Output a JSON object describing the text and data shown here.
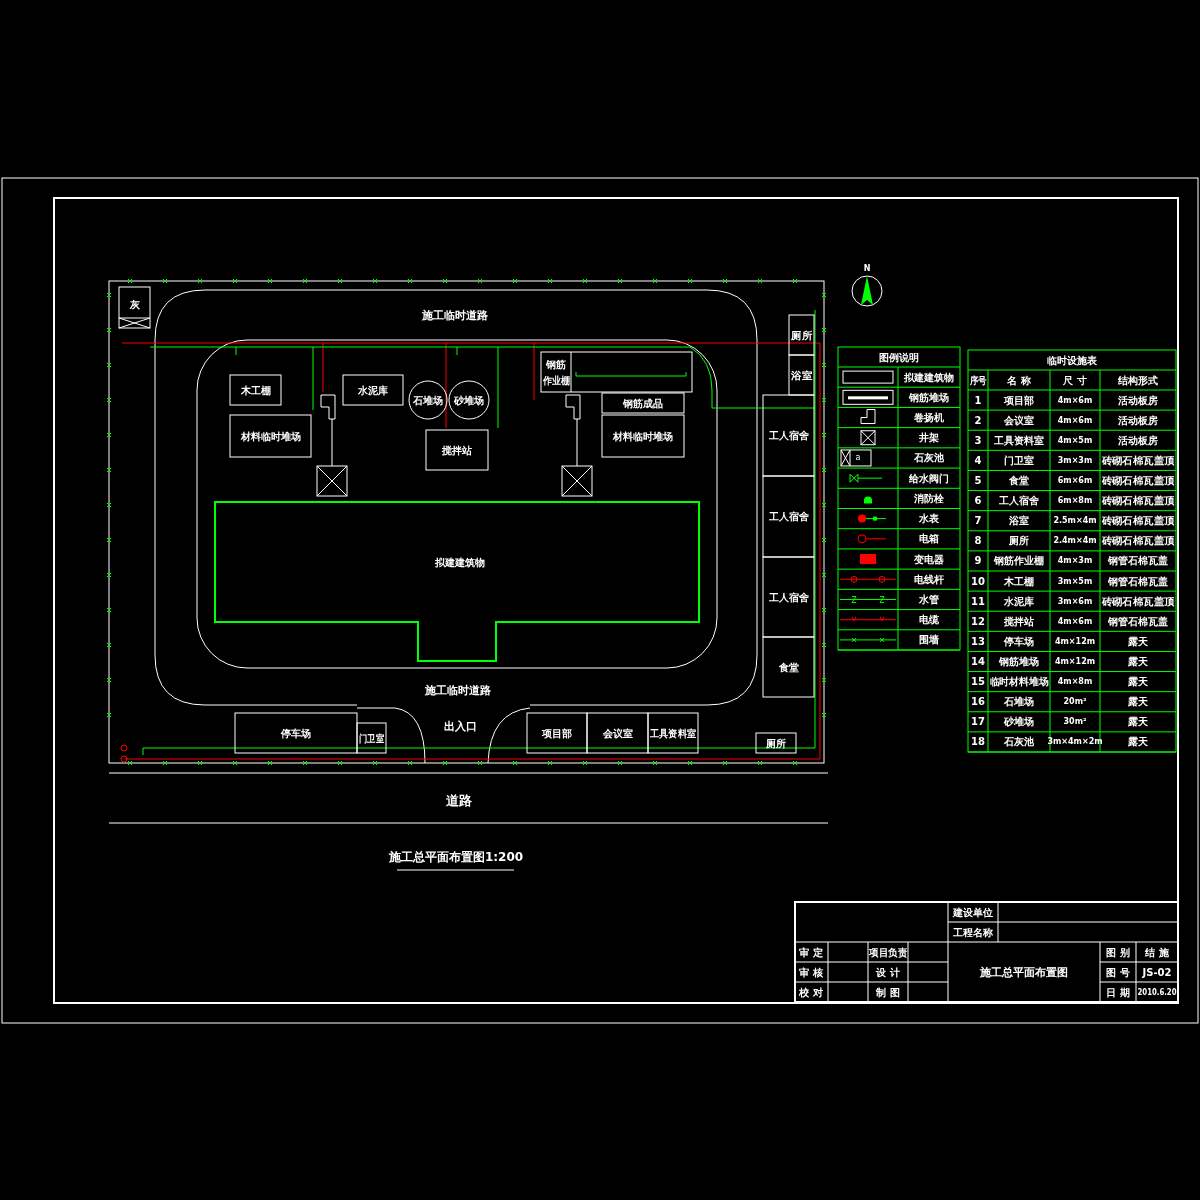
{
  "site_plan": {
    "road_labels": [
      "施工临时道路",
      "施工临时道路"
    ],
    "entrance": "出入口",
    "street": "道路",
    "lime_pit": "灰",
    "main_building": "拟建建筑物",
    "piles": [
      "石堆场",
      "砂堆场"
    ],
    "rebar_shed": [
      "钢筋",
      "作业棚"
    ],
    "rooms": [
      "木工棚",
      "水泥库",
      "材料临时堆场",
      "搅拌站",
      "钢筋成品",
      "材料临时堆场",
      "厕所",
      "浴室",
      "工人宿舍",
      "工人宿舍",
      "工人宿舍",
      "食堂",
      "停车场",
      "门卫室",
      "项目部",
      "会议室",
      "工具资料室",
      "厕所"
    ],
    "north": "N"
  },
  "caption": "施工总平面布置图1:200",
  "legend": {
    "title": "图例说明",
    "items": [
      {
        "kind": "building",
        "label": "拟建建筑物"
      },
      {
        "kind": "rebar_yard",
        "label": "钢筋堆场"
      },
      {
        "kind": "hoist",
        "label": "卷扬机"
      },
      {
        "kind": "derrick",
        "label": "井架"
      },
      {
        "kind": "lime_pit",
        "label": "石灰池",
        "symbol_text": "a"
      },
      {
        "kind": "valve",
        "label": "给水阀门"
      },
      {
        "kind": "hydrant",
        "label": "消防栓"
      },
      {
        "kind": "water_meter",
        "label": "水表"
      },
      {
        "kind": "switchbox",
        "label": "电箱"
      },
      {
        "kind": "transformer",
        "label": "变电器"
      },
      {
        "kind": "pole_line",
        "label": "电线杆"
      },
      {
        "kind": "water_pipe",
        "label": "水管"
      },
      {
        "kind": "cable",
        "label": "电缆"
      },
      {
        "kind": "fence",
        "label": "围墙"
      }
    ]
  },
  "facility_table": {
    "title": "临时设施表",
    "columns": [
      "序号",
      "名 称",
      "尺 寸",
      "结构形式"
    ],
    "rows": [
      [
        "1",
        "项目部",
        "4m×6m",
        "活动板房"
      ],
      [
        "2",
        "会议室",
        "4m×6m",
        "活动板房"
      ],
      [
        "3",
        "工具资料室",
        "4m×5m",
        "活动板房"
      ],
      [
        "4",
        "门卫室",
        "3m×3m",
        "砖砌石棉瓦盖顶"
      ],
      [
        "5",
        "食堂",
        "6m×6m",
        "砖砌石棉瓦盖顶"
      ],
      [
        "6",
        "工人宿舍",
        "6m×8m",
        "砖砌石棉瓦盖顶"
      ],
      [
        "7",
        "浴室",
        "2.5m×4m",
        "砖砌石棉瓦盖顶"
      ],
      [
        "8",
        "厕所",
        "2.4m×4m",
        "砖砌石棉瓦盖顶"
      ],
      [
        "9",
        "钢筋作业棚",
        "4m×3m",
        "钢管石棉瓦盖"
      ],
      [
        "10",
        "木工棚",
        "3m×5m",
        "钢管石棉瓦盖"
      ],
      [
        "11",
        "水泥库",
        "3m×6m",
        "砖砌石棉瓦盖顶"
      ],
      [
        "12",
        "搅拌站",
        "4m×6m",
        "钢管石棉瓦盖"
      ],
      [
        "13",
        "停车场",
        "4m×12m",
        "露天"
      ],
      [
        "14",
        "钢筋堆场",
        "4m×12m",
        "露天"
      ],
      [
        "15",
        "临时材料堆场",
        "4m×8m",
        "露天"
      ],
      [
        "16",
        "石堆场",
        "20m²",
        "露天"
      ],
      [
        "17",
        "砂堆场",
        "30m²",
        "露天"
      ],
      [
        "18",
        "石灰池",
        "3m×4m×2m",
        "露天"
      ]
    ]
  },
  "title_block": {
    "fields": [
      "建设单位",
      "工程名称"
    ],
    "signoffs": [
      [
        "审 定",
        "项目负责"
      ],
      [
        "审 核",
        "设 计"
      ],
      [
        "校 对",
        "制 图"
      ]
    ],
    "drawing_title": "施工总平面布置图",
    "info": [
      [
        "图 别",
        "结 施"
      ],
      [
        "图 号",
        "JS-02"
      ],
      [
        "日 期",
        "2010.6.20"
      ]
    ]
  }
}
